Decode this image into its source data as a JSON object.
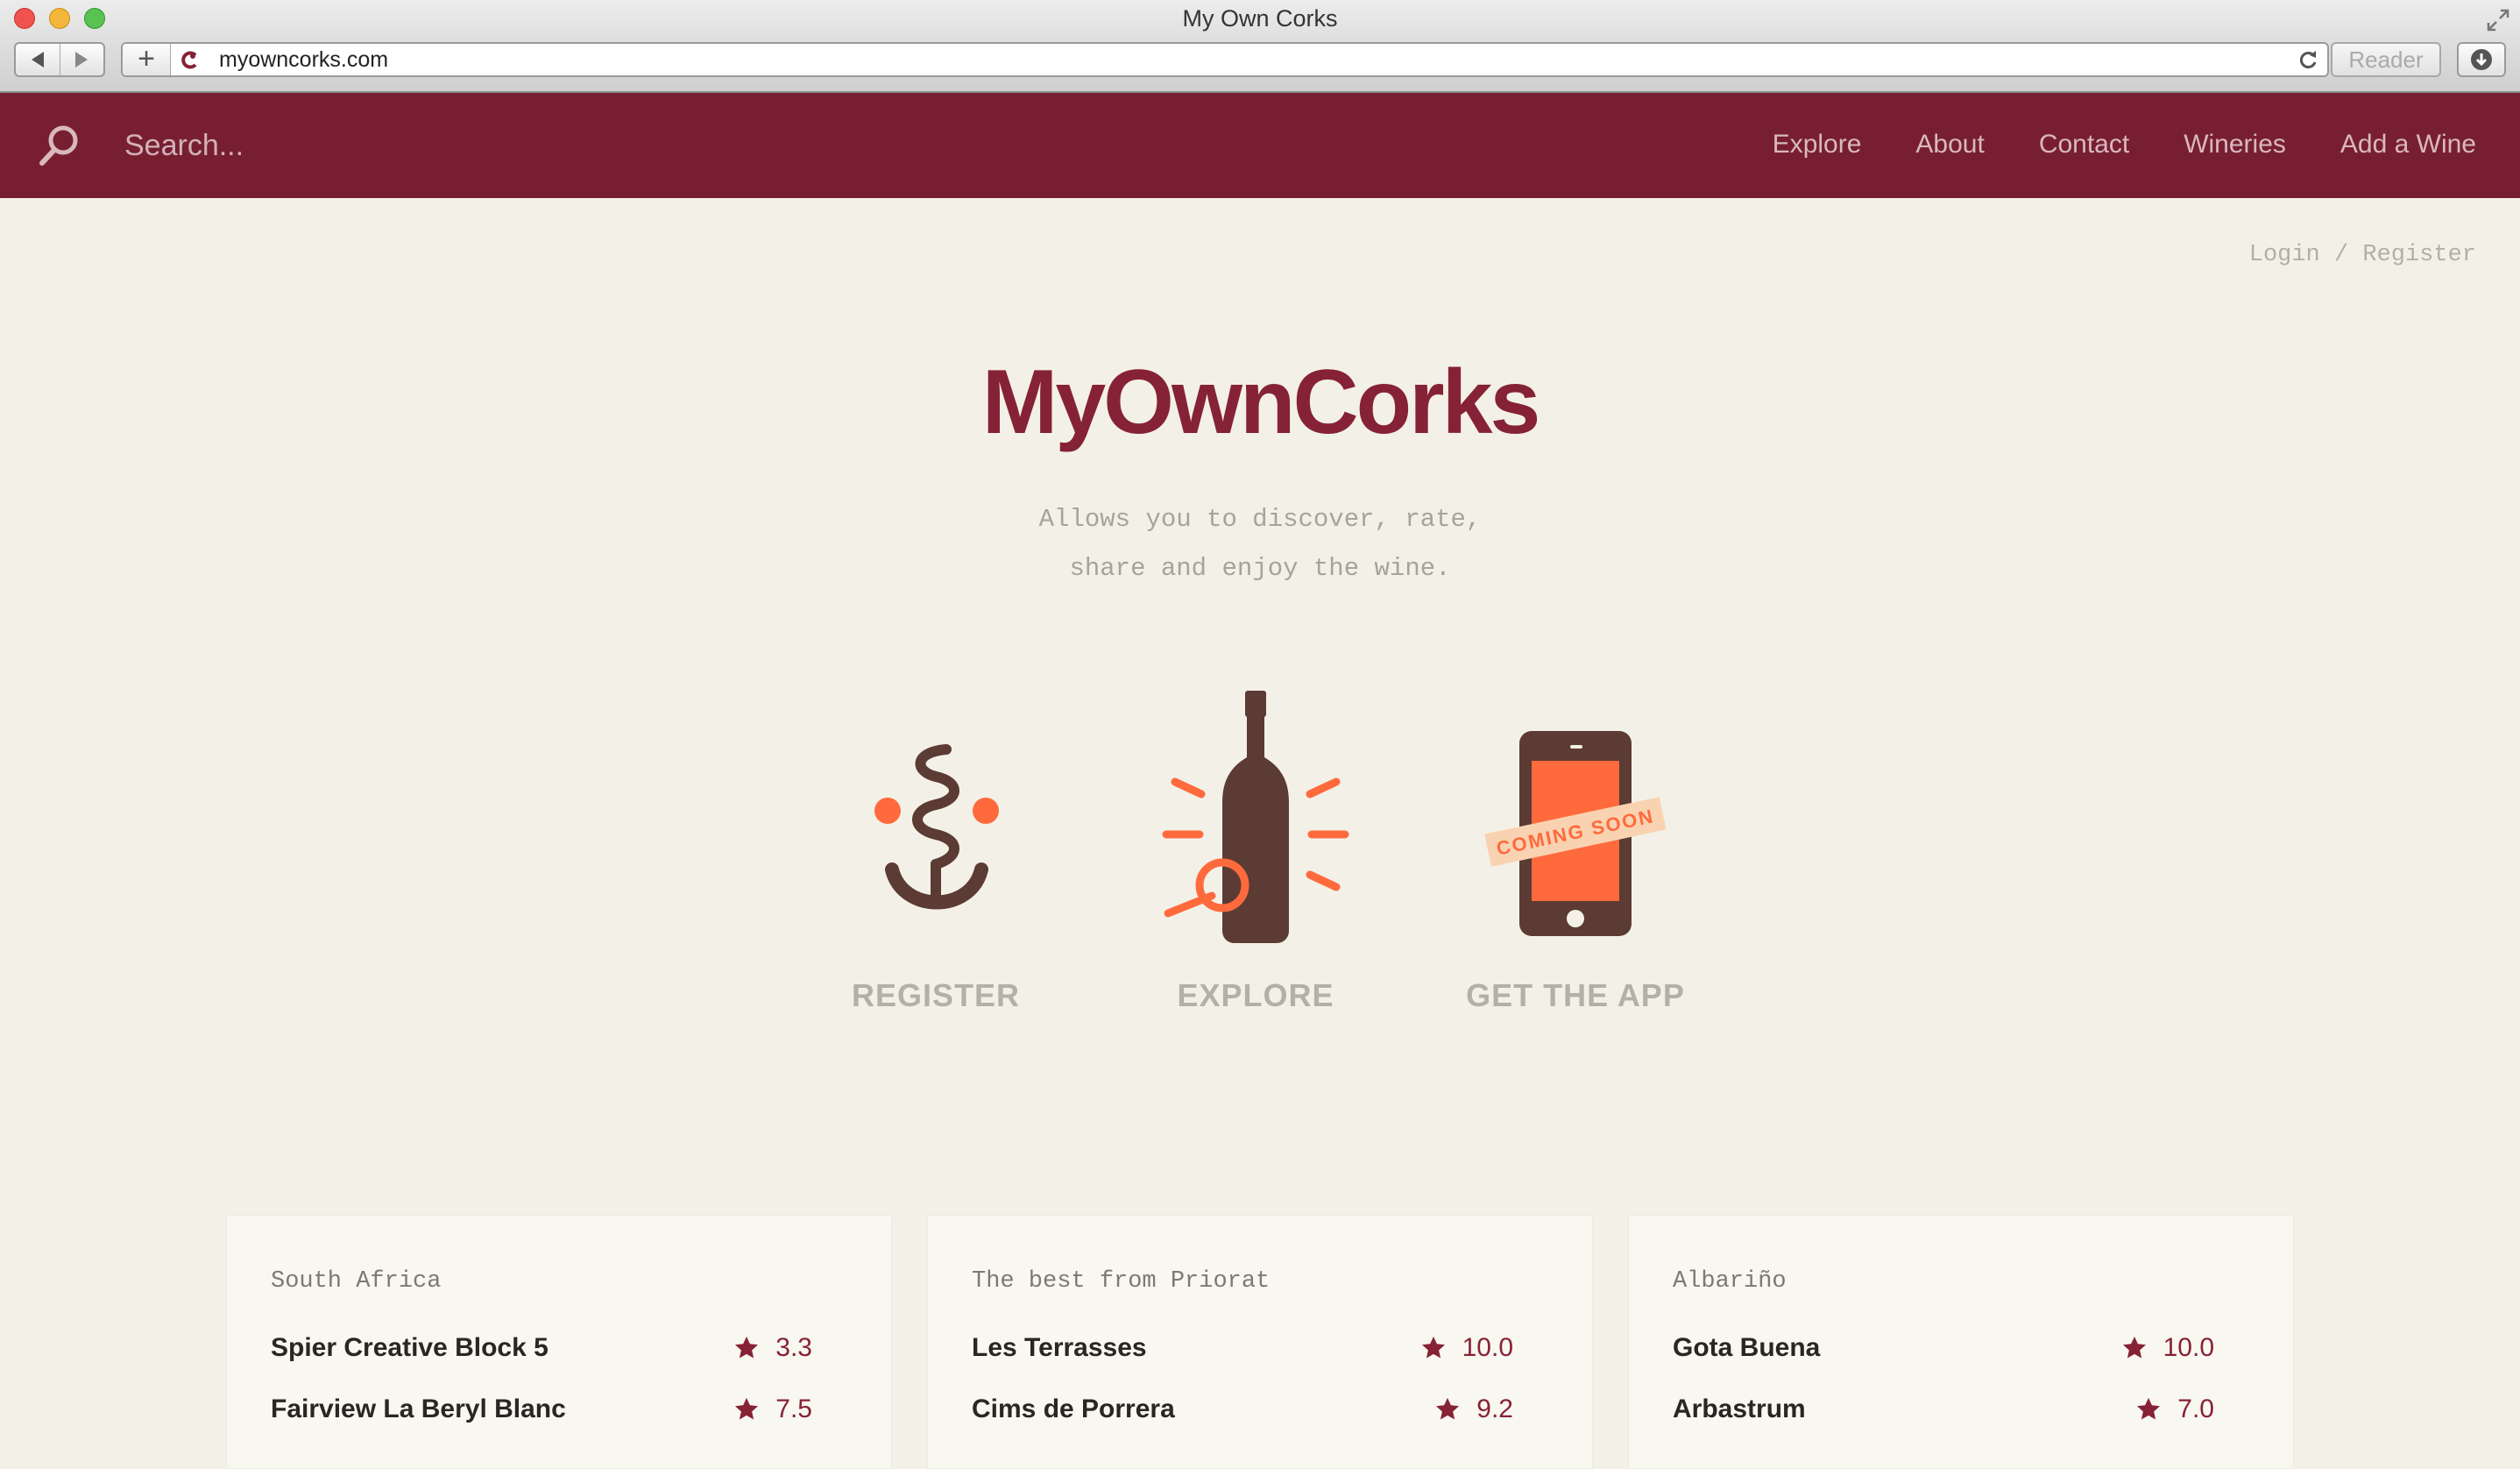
{
  "browser": {
    "window_title": "My Own Corks",
    "url": "myowncorks.com",
    "reader_label": "Reader"
  },
  "header": {
    "search_placeholder": "Search...",
    "nav": [
      "Explore",
      "About",
      "Contact",
      "Wineries",
      "Add a Wine"
    ]
  },
  "auth": {
    "login": "Login",
    "separator": "/",
    "register": "Register"
  },
  "hero": {
    "logo": "MyOwnCorks",
    "tagline_line1": "Allows you to discover, rate,",
    "tagline_line2": "share and enjoy the wine."
  },
  "features": [
    {
      "label": "REGISTER",
      "icon": "corkscrew-icon"
    },
    {
      "label": "EXPLORE",
      "icon": "wine-bottle-icon"
    },
    {
      "label": "GET THE APP",
      "icon": "smartphone-icon",
      "badge": "COMING SOON"
    }
  ],
  "lists": [
    {
      "title": "South Africa",
      "wines": [
        {
          "name": "Spier Creative Block 5",
          "rating": "3.3"
        },
        {
          "name": "Fairview La Beryl Blanc",
          "rating": "7.5"
        }
      ]
    },
    {
      "title": "The best from Priorat",
      "wines": [
        {
          "name": "Les Terrasses",
          "rating": "10.0"
        },
        {
          "name": "Cims de Porrera",
          "rating": "9.2"
        }
      ]
    },
    {
      "title": "Albariño",
      "wines": [
        {
          "name": "Gota Buena",
          "rating": "10.0"
        },
        {
          "name": "Arbastrum",
          "rating": "7.0"
        }
      ]
    }
  ],
  "colors": {
    "brand": "#771f31",
    "accent": "#ff6a3d",
    "icon_brown": "#5b3b33",
    "background": "#f3f1e7"
  }
}
